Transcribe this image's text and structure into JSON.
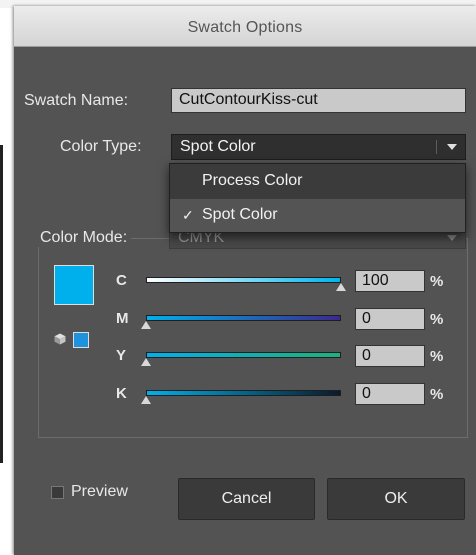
{
  "dialog": {
    "title": "Swatch Options",
    "swatch_name_label": "Swatch Name:",
    "swatch_name_value": "CutContourKiss-cut",
    "color_type_label": "Color Type:",
    "color_type_value": "Spot Color",
    "color_type_options": [
      "Process Color",
      "Spot Color"
    ],
    "color_mode_label": "Color Mode:",
    "color_mode_value": "CMYK",
    "preview_label": "Preview",
    "preview_checked": false,
    "cancel_label": "Cancel",
    "ok_label": "OK",
    "swatch_color": "#00b0ec"
  },
  "channels": [
    {
      "label": "C",
      "value": "100",
      "unit": "%",
      "slider_fraction": 1.0
    },
    {
      "label": "M",
      "value": "0",
      "unit": "%",
      "slider_fraction": 0.0
    },
    {
      "label": "Y",
      "value": "0",
      "unit": "%",
      "slider_fraction": 0.0
    },
    {
      "label": "K",
      "value": "0",
      "unit": "%",
      "slider_fraction": 0.0
    }
  ],
  "icons": {
    "checkmark": "✓",
    "out_of_gamut": "cube-icon",
    "dropdown": "chevron-down-icon"
  }
}
